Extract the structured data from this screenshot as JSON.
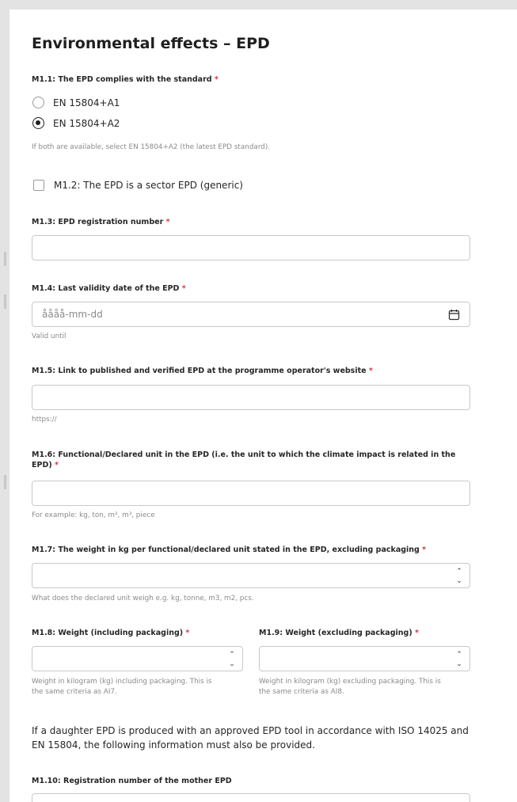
{
  "form": {
    "title": "Environmental effects – EPD",
    "m1_1": {
      "label": "M1.1: The EPD complies with the standard ",
      "required": "*",
      "options": [
        {
          "label": "EN 15804+A1",
          "checked": false
        },
        {
          "label": "EN 15804+A2",
          "checked": true
        }
      ],
      "hint": "If both are available, select EN 15804+A2 (the latest EPD standard)."
    },
    "m1_2": {
      "label": "M1.2: The EPD is a sector EPD (generic)",
      "checked": false
    },
    "m1_3": {
      "label": "M1.3: EPD registration number ",
      "required": "*",
      "value": ""
    },
    "m1_4": {
      "label": "M1.4: Last validity date of the EPD ",
      "required": "*",
      "placeholder": "åååå-mm-dd",
      "hint": "Valid until"
    },
    "m1_5": {
      "label": "M1.5: Link to published and verified EPD at the programme operator's website ",
      "required": "*",
      "value": "",
      "hint": "https://"
    },
    "m1_6": {
      "label_line1": "M1.6: Functional/Declared unit in the EPD (i.e. the unit to which the climate impact is related in the",
      "label_line2": "EPD) ",
      "required": "*",
      "value": "",
      "hint": "For example: kg, ton, m², m³, piece"
    },
    "m1_7": {
      "label": "M1.7: The weight in kg per functional/declared unit stated in the EPD, excluding packaging ",
      "required": "*",
      "value": "",
      "hint": "What does the declared unit weigh e.g. kg, tonne, m3, m2, pcs."
    },
    "m1_8": {
      "label": "M1.8: Weight (including packaging) ",
      "required": "*",
      "value": "",
      "hint_line1": "Weight in kilogram (kg) including packaging. This is",
      "hint_line2": "the same criteria as AI7."
    },
    "m1_9": {
      "label": "M1.9: Weight (excluding packaging) ",
      "required": "*",
      "value": "",
      "hint_line1": "Weight in kilogram (kg) excluding packaging. This is",
      "hint_line2": "the same criteria as AI8."
    },
    "daughter_info_line1": "If a daughter EPD is produced with an approved EPD tool in accordance with ISO 14025 and",
    "daughter_info_line2": "EN 15804, the following information must also be provided.",
    "m1_10": {
      "label": "M1.10: Registration number of the mother EPD",
      "value": ""
    }
  },
  "icons": {
    "calendar": "calendar-icon",
    "spin_up": "chevron-up-icon",
    "spin_down": "chevron-down-icon"
  },
  "colors": {
    "required": "#d23c3c",
    "border": "#c9c9c9",
    "hint": "#8a8a8a"
  }
}
